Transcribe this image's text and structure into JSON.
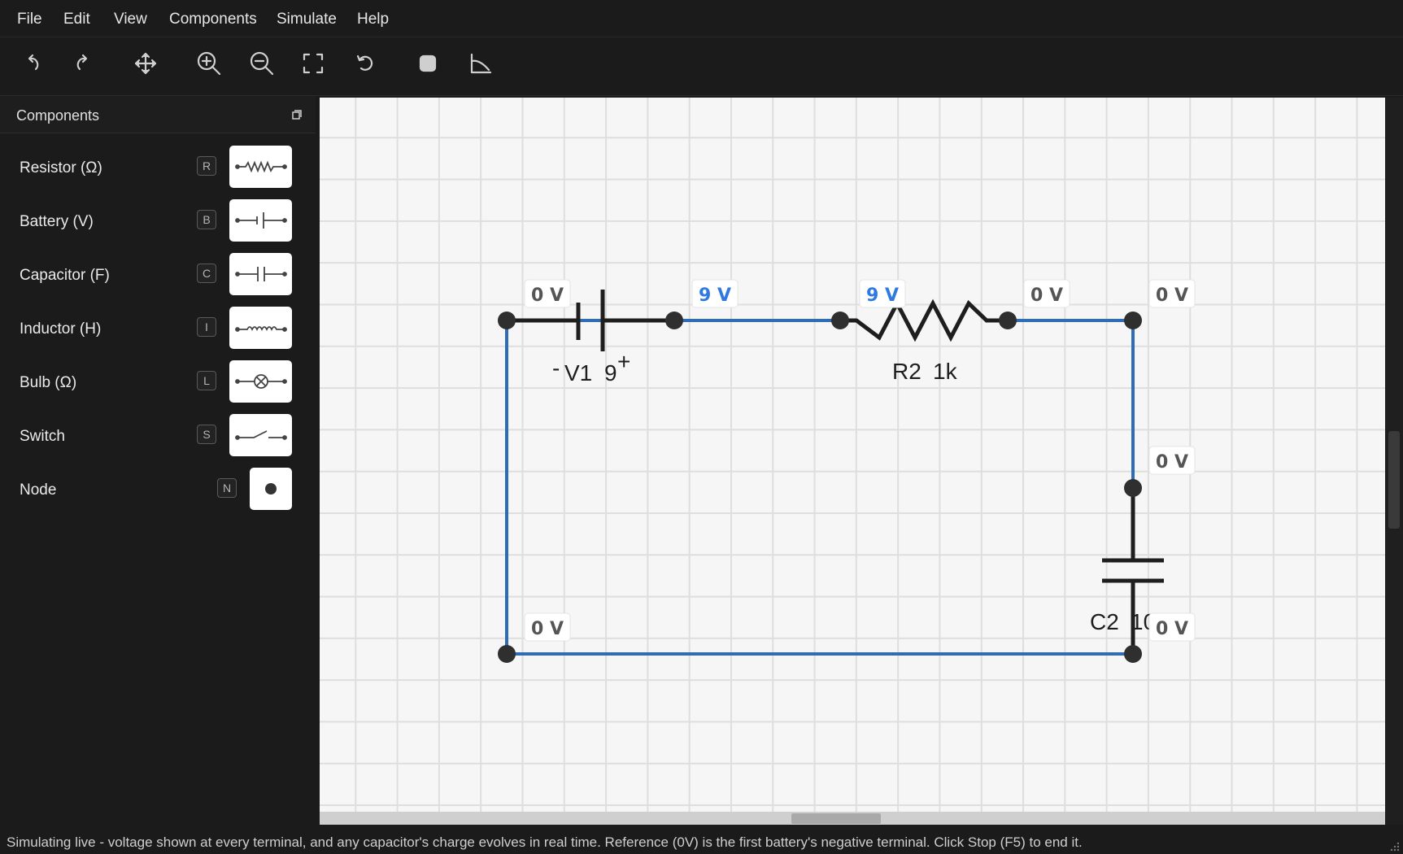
{
  "menu": [
    "File",
    "Edit",
    "View",
    "Components",
    "Simulate",
    "Help"
  ],
  "toolbar": [
    {
      "name": "undo-icon"
    },
    {
      "name": "redo-icon"
    },
    {
      "name": "pan-icon"
    },
    {
      "name": "zoom-in-icon"
    },
    {
      "name": "zoom-out-icon"
    },
    {
      "name": "fit-view-icon"
    },
    {
      "name": "reset-view-icon"
    },
    {
      "name": "stop-icon"
    },
    {
      "name": "graph-icon"
    }
  ],
  "sidebar": {
    "title": "Components",
    "items": [
      {
        "label": "Resistor (Ω)",
        "key": "R",
        "icon": "resistor-symbol-icon"
      },
      {
        "label": "Battery (V)",
        "key": "B",
        "icon": "battery-symbol-icon"
      },
      {
        "label": "Capacitor (F)",
        "key": "C",
        "icon": "capacitor-symbol-icon"
      },
      {
        "label": "Inductor (H)",
        "key": "I",
        "icon": "inductor-symbol-icon"
      },
      {
        "label": "Bulb (Ω)",
        "key": "L",
        "icon": "bulb-symbol-icon"
      },
      {
        "label": "Switch",
        "key": "S",
        "icon": "switch-symbol-icon"
      },
      {
        "label": "Node",
        "key": "N",
        "icon": "node-symbol-icon"
      }
    ]
  },
  "circuit": {
    "wire_color": "#2e6db4",
    "active_voltage_color": "#2f7ae0",
    "zero_voltage_color": "#555555",
    "voltages": {
      "battery_neg": "0 V",
      "battery_pos": "9 V",
      "resistor_left": "9 V",
      "resistor_right": "0 V",
      "top_right": "0 V",
      "cap_top": "0 V",
      "cap_bottom": "0 V",
      "bottom_left": "0 V"
    },
    "battery": {
      "name": "V1",
      "value": "9",
      "neg_sign": "-",
      "pos_sign": "+"
    },
    "resistor": {
      "name": "R2",
      "value": "1k"
    },
    "capacitor": {
      "name": "C2",
      "value": "10"
    }
  },
  "status": "Simulating live - voltage shown at every terminal, and any capacitor's charge evolves in real time. Reference (0V) is the first battery's negative terminal. Click Stop (F5) to end it."
}
